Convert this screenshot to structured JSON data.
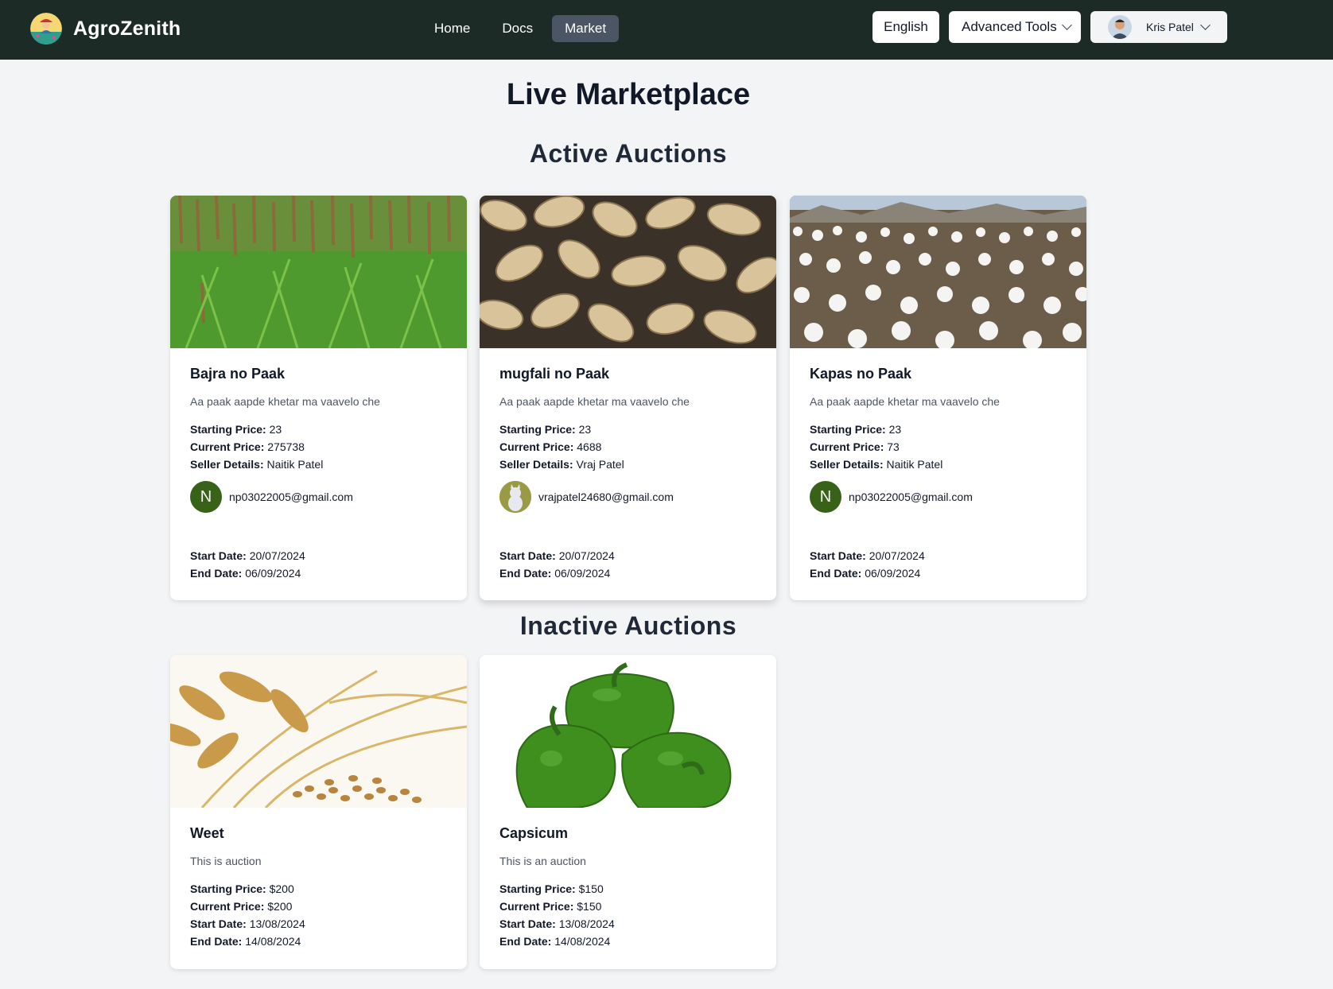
{
  "navbar": {
    "brand": "AgroZenith",
    "links": [
      {
        "label": "Home",
        "active": false
      },
      {
        "label": "Docs",
        "active": false
      },
      {
        "label": "Market",
        "active": true
      }
    ],
    "language_label": "English",
    "tools_label": "Advanced Tools",
    "user_name": "Kris Patel"
  },
  "page": {
    "title": "Live Marketplace",
    "active_heading": "Active Auctions",
    "inactive_heading": "Inactive Auctions"
  },
  "labels": {
    "starting_price": "Starting Price:",
    "current_price": "Current Price:",
    "seller_details": "Seller Details:",
    "start_date": "Start Date:",
    "end_date": "End Date:"
  },
  "active_auctions": [
    {
      "title": "Bajra no Paak",
      "description": "Aa paak aapde khetar ma vaavelo che",
      "starting_price": "23",
      "current_price": "275738",
      "seller_name": "Naitik Patel",
      "seller_initial": "N",
      "seller_email": "np03022005@gmail.com",
      "start_date": "20/07/2024",
      "end_date": "06/09/2024"
    },
    {
      "title": "mugfali no Paak",
      "description": "Aa paak aapde khetar ma vaavelo che",
      "starting_price": "23",
      "current_price": "4688",
      "seller_name": "Vraj Patel",
      "seller_initial": "",
      "seller_email": "vrajpatel24680@gmail.com",
      "start_date": "20/07/2024",
      "end_date": "06/09/2024"
    },
    {
      "title": "Kapas no Paak",
      "description": "Aa paak aapde khetar ma vaavelo che",
      "starting_price": "23",
      "current_price": "73",
      "seller_name": "Naitik Patel",
      "seller_initial": "N",
      "seller_email": "np03022005@gmail.com",
      "start_date": "20/07/2024",
      "end_date": "06/09/2024"
    }
  ],
  "inactive_auctions": [
    {
      "title": "Weet",
      "description": "This is auction",
      "starting_price": "$200",
      "current_price": "$200",
      "start_date": "13/08/2024",
      "end_date": "14/08/2024"
    },
    {
      "title": "Capsicum",
      "description": "This is an auction",
      "starting_price": "$150",
      "current_price": "$150",
      "start_date": "13/08/2024",
      "end_date": "14/08/2024"
    }
  ],
  "icons": {
    "logo": "farmer-logo-icon",
    "chevron": "chevron-down-icon"
  },
  "colors": {
    "navbar_bg": "#1c2b26",
    "active_nav_bg": "#4b5563",
    "seller_avatar_bg": "#376218",
    "page_bg": "#f3f4f6"
  }
}
